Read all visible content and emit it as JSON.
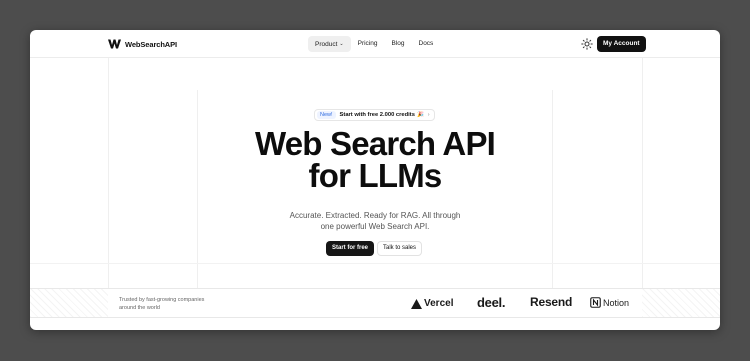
{
  "navbar": {
    "brand": "WebSearchAPI",
    "menu": [
      {
        "label": "Product",
        "has_dropdown": true,
        "active": true
      },
      {
        "label": "Pricing"
      },
      {
        "label": "Blog"
      },
      {
        "label": "Docs"
      }
    ],
    "theme_toggle_icon": "sun-icon",
    "account_button": "My Account"
  },
  "hero": {
    "badge": {
      "tag": "New!",
      "text": "Start with free 2.000 credits",
      "emoji": "🎉",
      "arrow": "›"
    },
    "title_line1": "Web Search API",
    "title_line2": "for LLMs",
    "subtitle": "Accurate. Extracted. Ready for RAG. All through one powerful Web Search API.",
    "primary_cta": "Start for free",
    "secondary_cta": "Talk to sales"
  },
  "trusted": {
    "text": "Trusted by fast-growing companies around the world",
    "logos": [
      {
        "name": "Vercel",
        "icon": "triangle-icon"
      },
      {
        "name": "deel."
      },
      {
        "name": "Resend"
      },
      {
        "name": "Notion",
        "icon": "notion-icon"
      }
    ]
  },
  "colors": {
    "backdrop": "#4d4d4d",
    "primary_button": "#161616",
    "badge_accent": "#2f6be0"
  }
}
